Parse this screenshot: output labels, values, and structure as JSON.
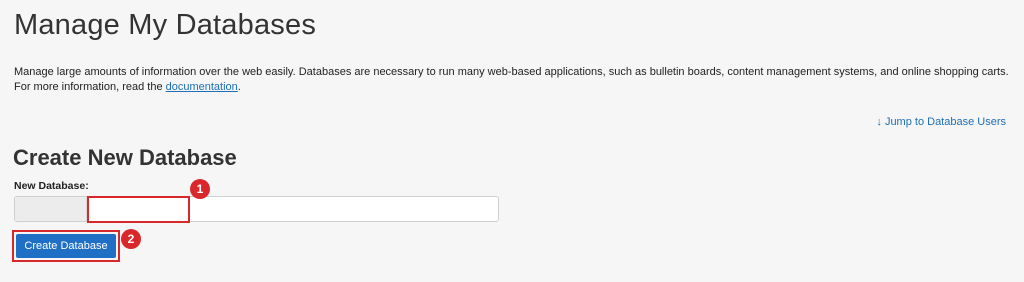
{
  "header": {
    "title": "Manage My Databases"
  },
  "intro": {
    "text": "Manage large amounts of information over the web easily. Databases are necessary to run many web-based applications, such as bulletin boards, content management systems, and online shopping carts. For more information, read the ",
    "link_label": "documentation",
    "trailing": "."
  },
  "jump_link": {
    "arrow": "↓",
    "label": "Jump to Database Users"
  },
  "create_section": {
    "title": "Create New Database",
    "field_label": "New Database:",
    "prefix_value": "",
    "input_value": "",
    "button_label": "Create Database"
  },
  "annotations": {
    "step1": "1",
    "step2": "2",
    "highlight_color": "#d9282b"
  },
  "colors": {
    "link": "#1d6fb8",
    "primary_button": "#1f6fc5",
    "background": "#f6f6f6"
  }
}
